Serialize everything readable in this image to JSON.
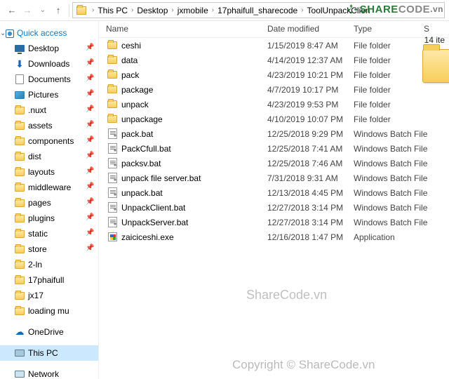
{
  "breadcrumbs": [
    "This PC",
    "Desktop",
    "jxmobile",
    "17phaifull_sharecode",
    "ToolUnpackClien"
  ],
  "logo": {
    "share": "SHARE",
    "code": "CODE",
    "vn": ".vn"
  },
  "quick_access": "Quick access",
  "sidebar_top": [
    {
      "label": "Desktop",
      "pin": true,
      "icon": "desk"
    },
    {
      "label": "Downloads",
      "pin": true,
      "icon": "down"
    },
    {
      "label": "Documents",
      "pin": true,
      "icon": "doc"
    },
    {
      "label": "Pictures",
      "pin": true,
      "icon": "pic"
    },
    {
      "label": ".nuxt",
      "pin": true,
      "icon": "folder"
    },
    {
      "label": "assets",
      "pin": true,
      "icon": "folder"
    },
    {
      "label": "components",
      "pin": true,
      "icon": "folder"
    },
    {
      "label": "dist",
      "pin": true,
      "icon": "folder"
    },
    {
      "label": "layouts",
      "pin": true,
      "icon": "folder"
    },
    {
      "label": "middleware",
      "pin": true,
      "icon": "folder"
    },
    {
      "label": "pages",
      "pin": true,
      "icon": "folder"
    },
    {
      "label": "plugins",
      "pin": true,
      "icon": "folder"
    },
    {
      "label": "static",
      "pin": true,
      "icon": "folder"
    },
    {
      "label": "store",
      "pin": true,
      "icon": "folder"
    },
    {
      "label": "2-ln",
      "pin": false,
      "icon": "folder"
    },
    {
      "label": "17phaifull",
      "pin": false,
      "icon": "folder"
    },
    {
      "label": "jx17",
      "pin": false,
      "icon": "folder"
    },
    {
      "label": "loading mu",
      "pin": false,
      "icon": "folder"
    }
  ],
  "sidebar_onedrive": "OneDrive",
  "sidebar_thispc": "This PC",
  "sidebar_network": "Network",
  "columns": {
    "name": "Name",
    "date": "Date modified",
    "type": "Type",
    "s": "S"
  },
  "count_text": "14 ite",
  "files": [
    {
      "name": "ceshi",
      "date": "1/15/2019 8:47 AM",
      "type": "File folder",
      "icon": "folder"
    },
    {
      "name": "data",
      "date": "4/14/2019 12:37 AM",
      "type": "File folder",
      "icon": "folder"
    },
    {
      "name": "pack",
      "date": "4/23/2019 10:21 PM",
      "type": "File folder",
      "icon": "folder"
    },
    {
      "name": "package",
      "date": "4/7/2019 10:17 PM",
      "type": "File folder",
      "icon": "folder"
    },
    {
      "name": "unpack",
      "date": "4/23/2019 9:53 PM",
      "type": "File folder",
      "icon": "folder"
    },
    {
      "name": "unpackage",
      "date": "4/10/2019 10:07 PM",
      "type": "File folder",
      "icon": "folder"
    },
    {
      "name": "pack.bat",
      "date": "12/25/2018 9:29 PM",
      "type": "Windows Batch File",
      "icon": "bat"
    },
    {
      "name": "PackCfull.bat",
      "date": "12/25/2018 7:41 AM",
      "type": "Windows Batch File",
      "icon": "bat"
    },
    {
      "name": "packsv.bat",
      "date": "12/25/2018 7:46 AM",
      "type": "Windows Batch File",
      "icon": "bat"
    },
    {
      "name": "unpack file server.bat",
      "date": "7/31/2018 9:31 AM",
      "type": "Windows Batch File",
      "icon": "bat"
    },
    {
      "name": "unpack.bat",
      "date": "12/13/2018 4:45 PM",
      "type": "Windows Batch File",
      "icon": "bat"
    },
    {
      "name": "UnpackClient.bat",
      "date": "12/27/2018 3:14 PM",
      "type": "Windows Batch File",
      "icon": "bat"
    },
    {
      "name": "UnpackServer.bat",
      "date": "12/27/2018 3:14 PM",
      "type": "Windows Batch File",
      "icon": "bat"
    },
    {
      "name": "zaiciceshi.exe",
      "date": "12/16/2018 1:47 PM",
      "type": "Application",
      "icon": "exe"
    }
  ],
  "watermark1": "ShareCode.vn",
  "watermark2": "Copyright © ShareCode.vn"
}
